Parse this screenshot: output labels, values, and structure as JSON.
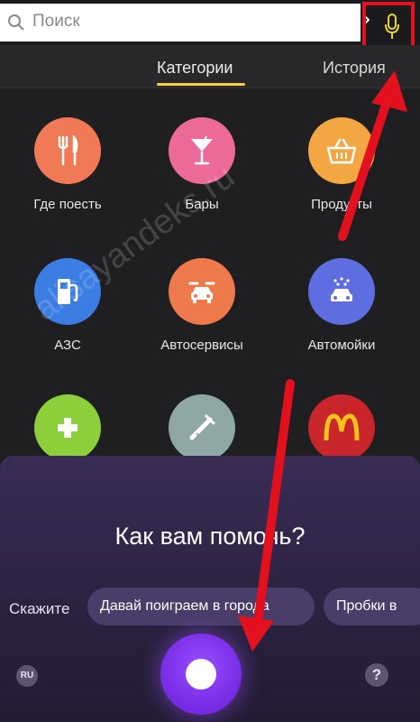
{
  "search": {
    "placeholder": "Поиск"
  },
  "tabs": [
    {
      "label": "Категории",
      "active": true
    },
    {
      "label": "История",
      "active": false
    }
  ],
  "categories": [
    {
      "label": "Где поесть",
      "icon": "fork-knife-icon",
      "color": "#ef7a55"
    },
    {
      "label": "Бары",
      "icon": "cocktail-icon",
      "color": "#ec6a98"
    },
    {
      "label": "Продукты",
      "icon": "basket-icon",
      "color": "#f3a742"
    },
    {
      "label": "АЗС",
      "icon": "fuel-pump-icon",
      "color": "#3b7de3"
    },
    {
      "label": "Автосервисы",
      "icon": "car-service-icon",
      "color": "#ee7a4c"
    },
    {
      "label": "Автомойки",
      "icon": "car-wash-icon",
      "color": "#5e6ee0"
    },
    {
      "label": "",
      "icon": "pharmacy-cross-icon",
      "color": "#8ccf3a"
    },
    {
      "label": "",
      "icon": "crutch-icon",
      "color": "#8fa8a6"
    },
    {
      "label": "",
      "icon": "mcdonalds-logo-icon",
      "color": "#c8262a"
    }
  ],
  "alice": {
    "title": "Как вам помочь?",
    "suggest_prompt": "Скажите",
    "chips": [
      "Давай поиграем в города",
      "Пробки в"
    ],
    "lang": "RU",
    "help": "?"
  },
  "watermark": "alisayandeks.ru",
  "colors": {
    "accent": "#f5d23d",
    "highlight": "#e3101e",
    "panel": "#2b2240",
    "alice_button": "#7a2fe6"
  }
}
